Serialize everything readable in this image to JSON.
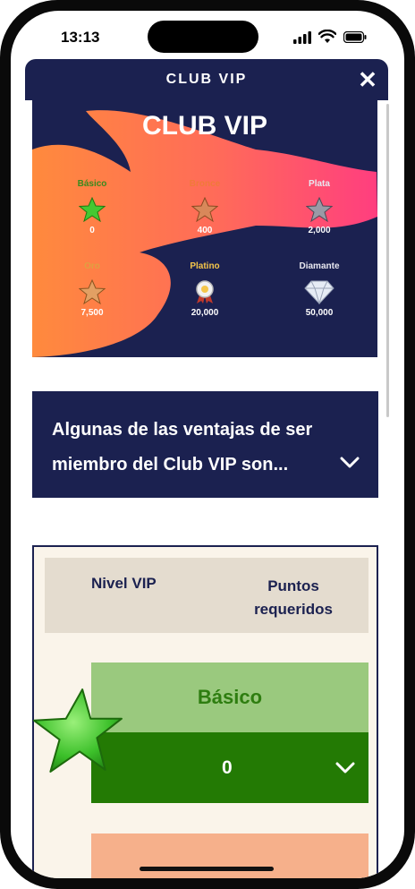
{
  "status_bar": {
    "time": "13:13"
  },
  "modal": {
    "title": "CLUB VIP",
    "close_label": "✕"
  },
  "banner": {
    "title": "CLUB VIP",
    "tiers": [
      {
        "name": "Básico",
        "points": "0",
        "color": "#3a8a1e"
      },
      {
        "name": "Bronce",
        "points": "400",
        "color": "#f07a3a"
      },
      {
        "name": "Plata",
        "points": "2,000",
        "color": "#e8e8f0"
      },
      {
        "name": "Oro",
        "points": "7,500",
        "color": "#e0a040"
      },
      {
        "name": "Platino",
        "points": "20,000",
        "color": "#f5c64a"
      },
      {
        "name": "Diamante",
        "points": "50,000",
        "color": "#e8e8f0"
      }
    ]
  },
  "accordion": {
    "text": "Algunas de las ventajas de ser miembro del Club VIP son..."
  },
  "table": {
    "header_level": "Nivel VIP",
    "header_points": "Puntos requeridos",
    "rows": [
      {
        "level": "Básico",
        "points": "0"
      }
    ]
  },
  "colors": {
    "navy": "#1b2150",
    "green_dark": "#237a04",
    "green_light": "#9ac97e",
    "cream": "#faf4ea",
    "peach": "#f6b08b"
  }
}
